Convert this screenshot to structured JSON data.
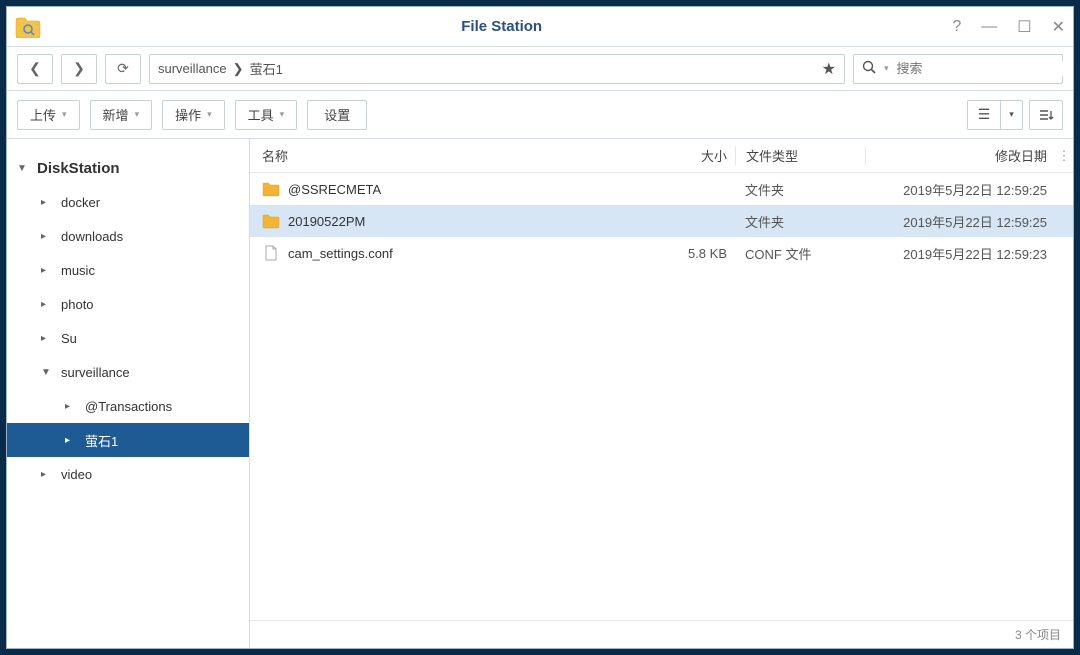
{
  "title": "File Station",
  "breadcrumbs": [
    "surveillance",
    "萤石1"
  ],
  "search_placeholder": "搜索",
  "toolbar": {
    "upload": "上传",
    "new": "新增",
    "action": "操作",
    "tools": "工具",
    "settings": "设置"
  },
  "sidebar": {
    "root": "DiskStation",
    "items": [
      {
        "label": "docker",
        "expanded": false
      },
      {
        "label": "downloads",
        "expanded": false
      },
      {
        "label": "music",
        "expanded": false
      },
      {
        "label": "photo",
        "expanded": false
      },
      {
        "label": "Su",
        "expanded": false
      },
      {
        "label": "surveillance",
        "expanded": true,
        "children": [
          {
            "label": "@Transactions",
            "expanded": false
          },
          {
            "label": "萤石1",
            "selected": true
          }
        ]
      },
      {
        "label": "video",
        "expanded": false
      }
    ]
  },
  "columns": {
    "name": "名称",
    "size": "大小",
    "type": "文件类型",
    "date": "修改日期"
  },
  "files": [
    {
      "icon": "folder",
      "name": "@SSRECMETA",
      "size": "",
      "type": "文件夹",
      "date": "2019年5月22日 12:59:25",
      "selected": false
    },
    {
      "icon": "folder",
      "name": "20190522PM",
      "size": "",
      "type": "文件夹",
      "date": "2019年5月22日 12:59:25",
      "selected": true
    },
    {
      "icon": "file",
      "name": "cam_settings.conf",
      "size": "5.8 KB",
      "type": "CONF 文件",
      "date": "2019年5月22日 12:59:23",
      "selected": false
    }
  ],
  "status": "3 个项目"
}
